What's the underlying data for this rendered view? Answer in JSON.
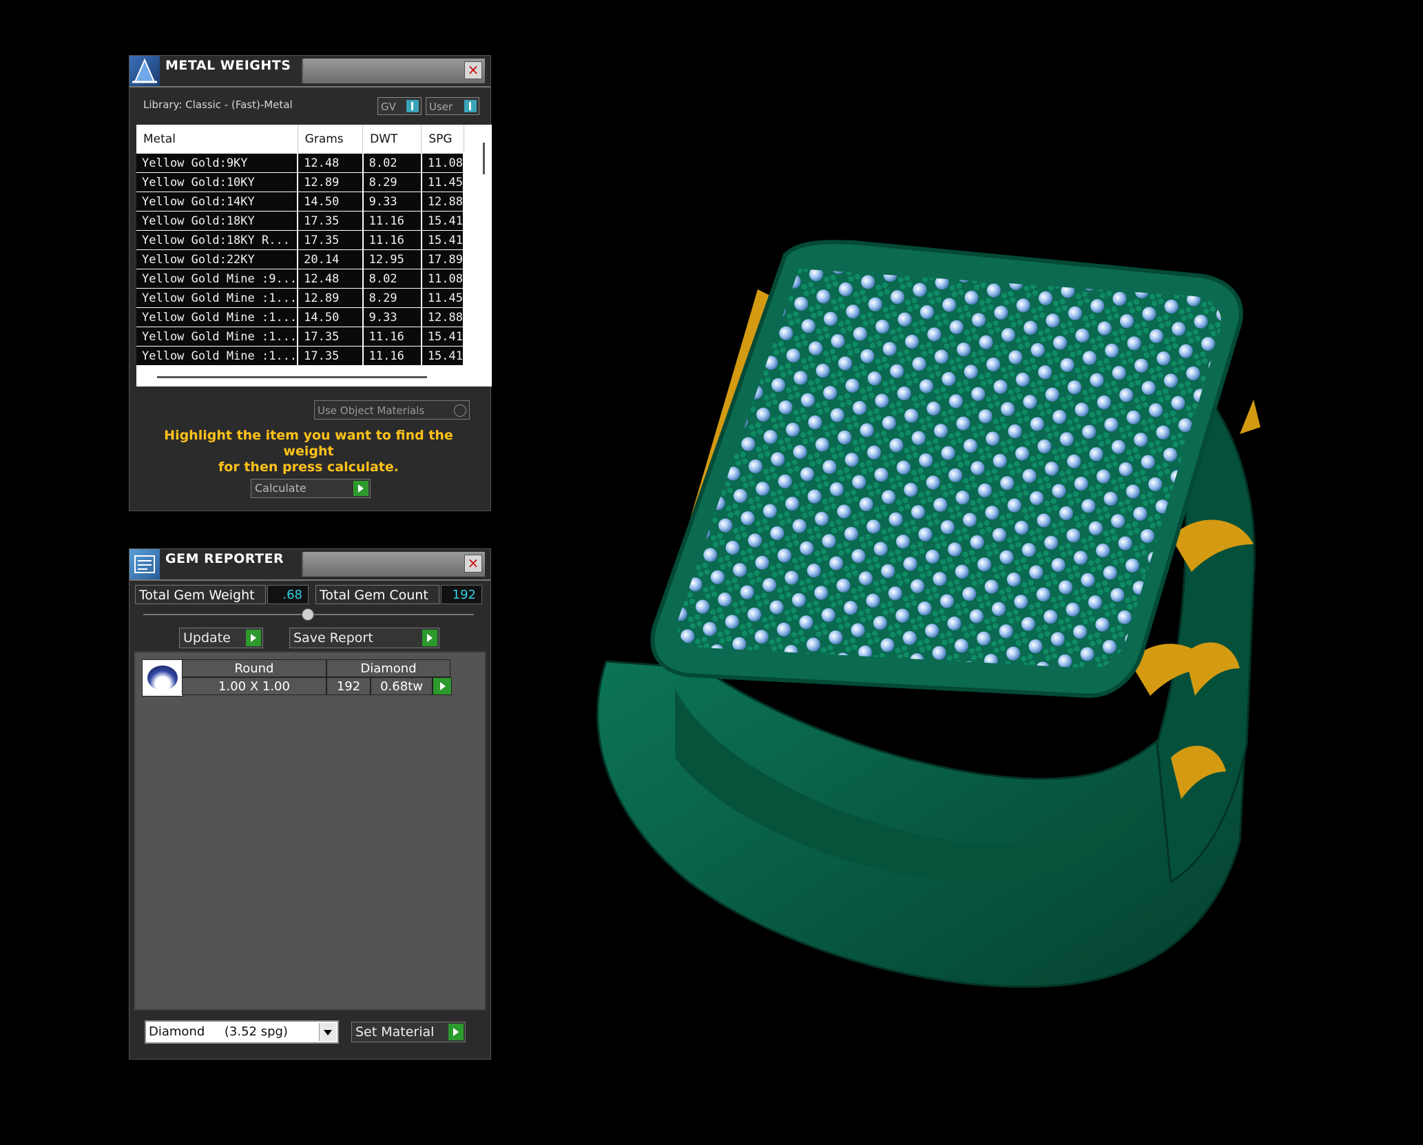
{
  "metal_weights": {
    "title": "METAL WEIGHTS",
    "library": "Library: Classic - (Fast)-Metal",
    "toggle_gv": "GV",
    "toggle_user": "User",
    "columns": [
      "Metal",
      "Grams",
      "DWT",
      "SPG"
    ],
    "rows": [
      [
        "Yellow Gold:9KY",
        "12.48",
        "8.02",
        "11.08"
      ],
      [
        "Yellow Gold:10KY",
        "12.89",
        "8.29",
        "11.45"
      ],
      [
        "Yellow Gold:14KY",
        "14.50",
        "9.33",
        "12.88"
      ],
      [
        "Yellow Gold:18KY",
        "17.35",
        "11.16",
        "15.41"
      ],
      [
        "Yellow Gold:18KY R...",
        "17.35",
        "11.16",
        "15.41"
      ],
      [
        "Yellow Gold:22KY",
        "20.14",
        "12.95",
        "17.89"
      ],
      [
        "Yellow Gold Mine :9...",
        "12.48",
        "8.02",
        "11.08"
      ],
      [
        "Yellow Gold Mine :1...",
        "12.89",
        "8.29",
        "11.45"
      ],
      [
        "Yellow Gold Mine :1...",
        "14.50",
        "9.33",
        "12.88"
      ],
      [
        "Yellow Gold Mine :1...",
        "17.35",
        "11.16",
        "15.41"
      ],
      [
        "Yellow Gold Mine :1...",
        "17.35",
        "11.16",
        "15.41"
      ]
    ],
    "use_object_materials": "Use Object Materials",
    "hint_line1": "Highlight the item you want to find the weight",
    "hint_line2": "for then press calculate.",
    "calculate": "Calculate"
  },
  "gem_reporter": {
    "title": "GEM REPORTER",
    "total_weight_label": "Total Gem Weight",
    "total_weight_value": ".68",
    "total_count_label": "Total Gem Count",
    "total_count_value": "192",
    "update": "Update",
    "save_report": "Save Report",
    "gem": {
      "shape": "Round",
      "material": "Diamond",
      "size": "1.00 X 1.00",
      "count": "192",
      "weight": "0.68tw"
    },
    "material_select": "Diamond     (3.52 spg)",
    "set_material": "Set Material"
  },
  "colors": {
    "metal": "#0a5f47",
    "gold": "#d49a12",
    "gem": "#9fc4f0",
    "hint": "#ffc21a",
    "value": "#32d2e6"
  }
}
